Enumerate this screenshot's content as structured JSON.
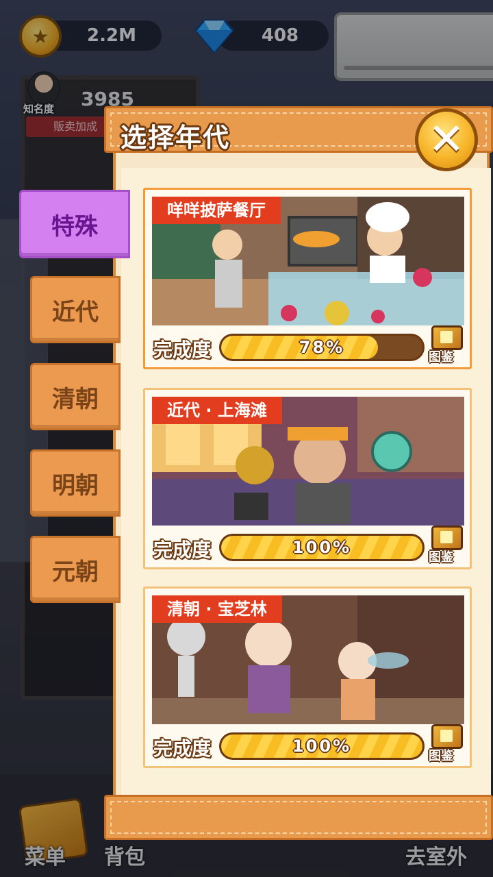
{
  "hud": {
    "coins": "2.2M",
    "gems": "408",
    "fame_label": "知名度",
    "fame_value": "3985",
    "fame_bonus": "贩卖加成"
  },
  "bottom_nav": {
    "menu": "菜单",
    "bag": "背包",
    "outdoor": "去室外"
  },
  "dialog": {
    "title": "选择年代",
    "close_icon": "close-x-icon"
  },
  "tabs": [
    {
      "label": "特殊",
      "active": true
    },
    {
      "label": "近代",
      "active": false
    },
    {
      "label": "清朝",
      "active": false
    },
    {
      "label": "明朝",
      "active": false
    },
    {
      "label": "元朝",
      "active": false
    }
  ],
  "cards": [
    {
      "tag": "咩咩披萨餐厅",
      "progress_label": "完成度",
      "progress": 78,
      "progress_text": "78%",
      "atlas_label": "图鉴"
    },
    {
      "tag": "近代 · 上海滩",
      "progress_label": "完成度",
      "progress": 100,
      "progress_text": "100%",
      "atlas_label": "图鉴"
    },
    {
      "tag": "清朝 · 宝芝林",
      "progress_label": "完成度",
      "progress": 100,
      "progress_text": "100%",
      "atlas_label": "图鉴"
    }
  ],
  "colors": {
    "panel_orange": "#e89a4d",
    "active_tab": "#d580f0",
    "tag_red": "#e23d1f",
    "progress_yellow": "#ffd34a"
  }
}
